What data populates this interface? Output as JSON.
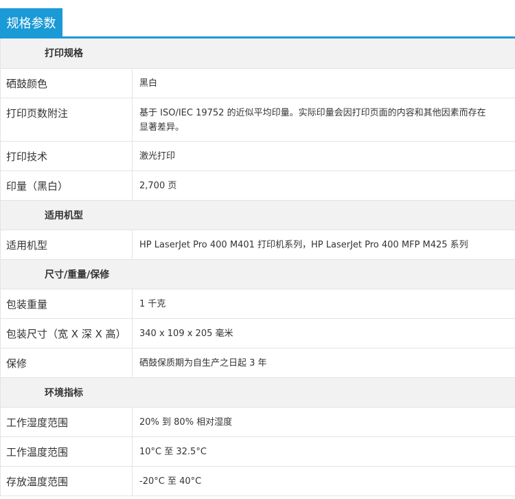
{
  "header": {
    "title": "规格参数"
  },
  "sections": [
    {
      "title": "打印规格",
      "rows": [
        {
          "label": "硒鼓颜色",
          "value": "黑白"
        },
        {
          "label": "打印页数附注",
          "value": "基于 ISO/IEC 19752 的近似平均印量。实际印量会因打印页面的内容和其他因素而存在显著差异。"
        },
        {
          "label": "打印技术",
          "value": "激光打印"
        },
        {
          "label": "印量（黑白）",
          "value": "2,700 页"
        }
      ]
    },
    {
      "title": "适用机型",
      "rows": [
        {
          "label": "适用机型",
          "value": "HP LaserJet Pro 400 M401 打印机系列，HP LaserJet Pro 400 MFP M425 系列"
        }
      ]
    },
    {
      "title": "尺寸/重量/保修",
      "rows": [
        {
          "label": "包装重量",
          "value": "1 千克"
        },
        {
          "label": "包装尺寸（宽 X 深 X 高）",
          "value": "340 x 109 x 205 毫米"
        },
        {
          "label": "保修",
          "value": "硒鼓保质期为自生产之日起 3 年"
        }
      ]
    },
    {
      "title": "环境指标",
      "rows": [
        {
          "label": "工作湿度范围",
          "value": "20% 到 80% 相对湿度"
        },
        {
          "label": "工作温度范围",
          "value": "10°C 至 32.5°C"
        },
        {
          "label": "存放温度范围",
          "value": "-20°C 至 40°C"
        }
      ]
    }
  ]
}
